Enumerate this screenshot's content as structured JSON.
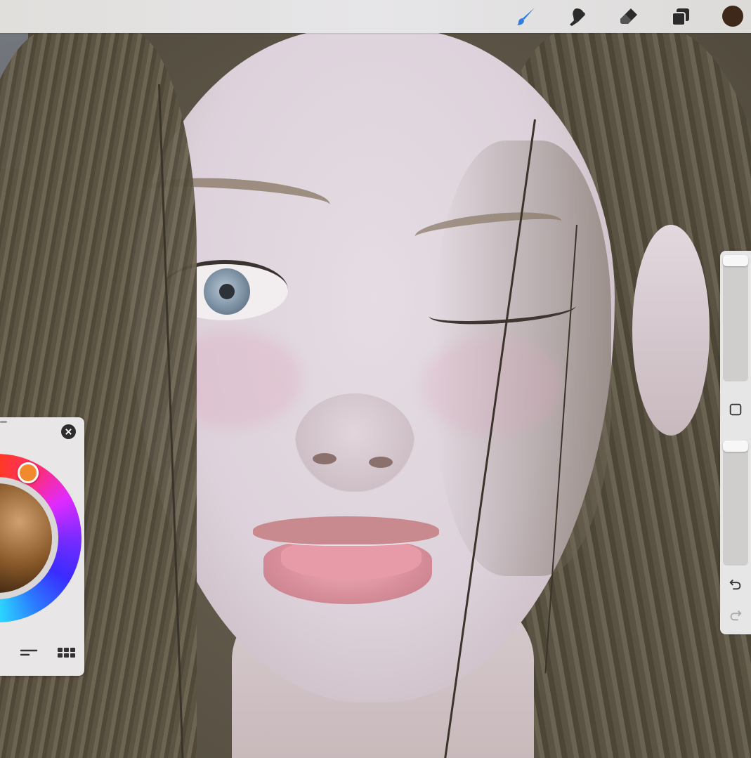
{
  "app": {
    "toolbar": {
      "tools": [
        {
          "name": "paintbrush-icon",
          "active": true
        },
        {
          "name": "smudge-icon",
          "active": false
        },
        {
          "name": "eraser-icon",
          "active": false
        },
        {
          "name": "layers-icon",
          "active": false
        }
      ],
      "current_color": "#3d2819",
      "accent_color": "#2f7de0"
    },
    "sidebar": {
      "brush_size": 1.0,
      "brush_opacity": 1.0,
      "modify_button": "square-icon",
      "undo": "undo-icon",
      "redo": "redo-icon"
    },
    "color_panel": {
      "close": "close-icon",
      "wheel_knob_color": "#f08a2c",
      "tabs": [
        "disc-icon",
        "sliders-icon",
        "palette-grid-icon"
      ]
    }
  }
}
